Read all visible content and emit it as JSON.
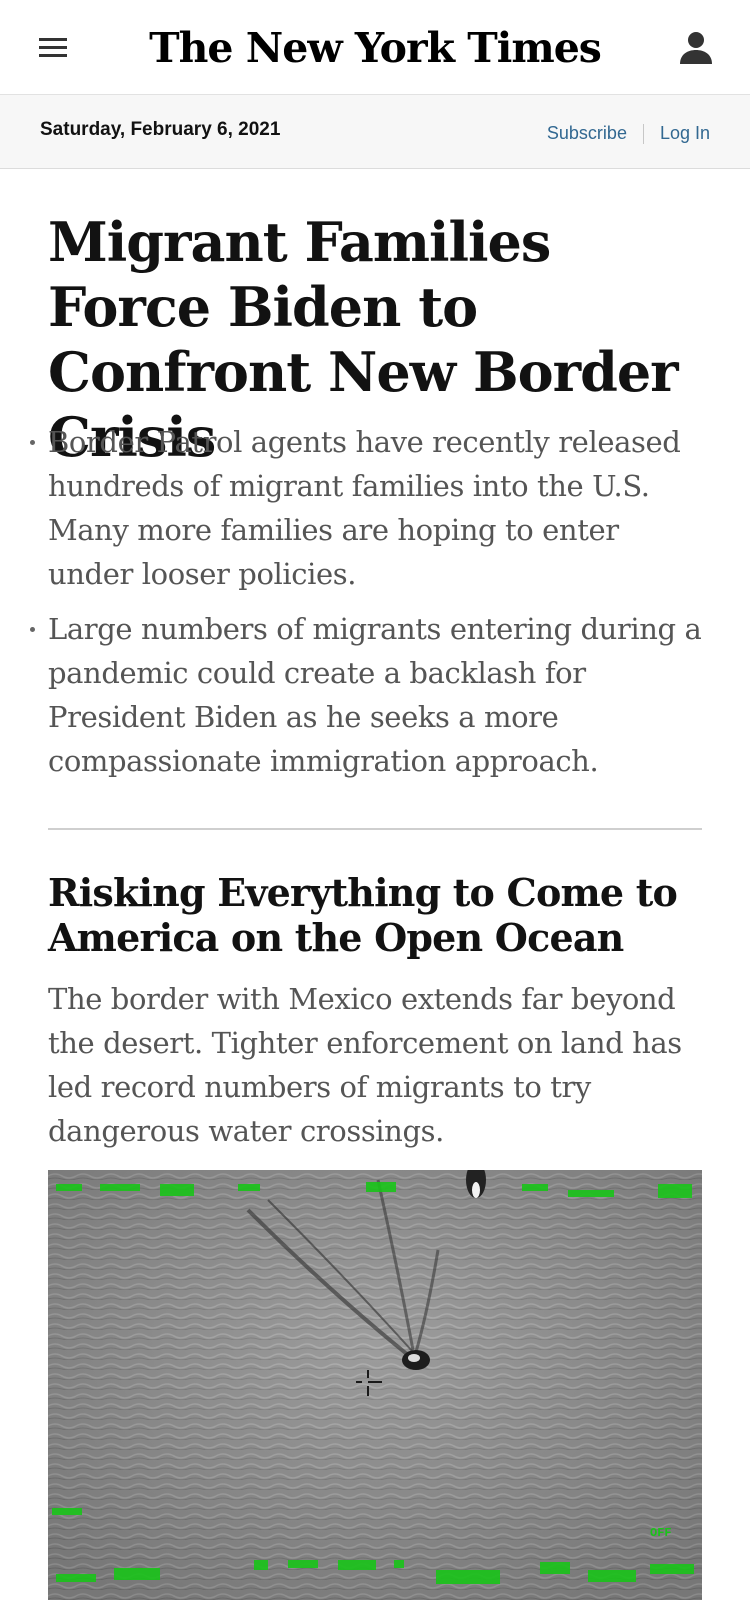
{
  "header": {
    "logo_text": "The New York Times"
  },
  "datebar": {
    "date": "Saturday, February 6, 2021",
    "subscribe_label": "Subscribe",
    "login_label": "Log In"
  },
  "lead_story": {
    "headline": "Migrant Families Force Biden to Confront New Border Crisis",
    "summary": [
      "Border Patrol agents have recently released hundreds of migrant families into the U.S. Many more families are hoping to enter under looser policies.",
      "Large numbers of migrants entering during a pandemic could create a backlash for President Biden as he seeks a more compassionate immigration approach."
    ]
  },
  "second_story": {
    "headline": "Risking Everything to Come to America on the Open Ocean",
    "summary": "The border with Mexico extends far beyond the desert. Tighter enforcement on land has led record numbers of migrants to try dangerous water crossings.",
    "photo_overlay_text": "OFF"
  },
  "colors": {
    "link": "#326891",
    "summary_text": "#555555",
    "headline_text": "#121212",
    "overlay_green": "#19c419"
  },
  "icons": {
    "menu": "hamburger-menu-icon",
    "account": "user-account-icon"
  }
}
